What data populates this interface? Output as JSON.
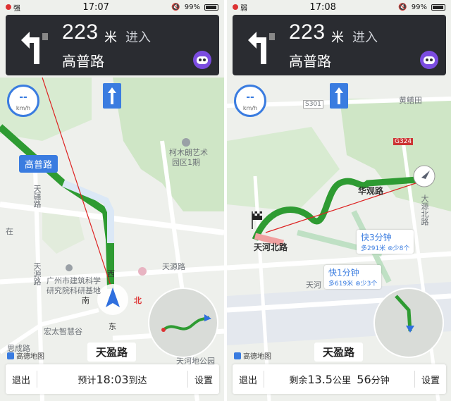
{
  "screens": [
    {
      "status": {
        "signal": "强",
        "time": "17:07",
        "battery": "99%"
      },
      "nav": {
        "distance": "223",
        "unit": "米",
        "action": "进入",
        "road": "高普路"
      },
      "speed": {
        "value": "--",
        "unit": "km/h"
      },
      "road_tag": "高普路",
      "labels": {
        "kemu": "柯木朗艺术",
        "kemu2": "园区1期",
        "tianzhen": "天疆路",
        "zai": "在",
        "tianyuan": "天源路",
        "institute1": "广州市建筑科学",
        "institute2": "研究院科研基地",
        "hongtai": "宏太智慧谷",
        "tianhe_park": "天河地公园",
        "tianyuan_lu": "天源路",
        "shi": "思成路"
      },
      "compass": {
        "west": "西",
        "south": "南",
        "east": "东",
        "north": "北"
      },
      "logo": "高德地图",
      "current_road": "天盈路",
      "bottom": {
        "exit": "退出",
        "middle_prefix": "预计",
        "middle_value": "18:03",
        "middle_suffix": "到达",
        "settings": "设置"
      }
    },
    {
      "status": {
        "signal": "弱",
        "time": "17:08",
        "battery": "99%"
      },
      "nav": {
        "distance": "223",
        "unit": "米",
        "action": "进入",
        "road": "高普路"
      },
      "speed": {
        "value": "--",
        "unit": "km/h"
      },
      "labels": {
        "huangjintian": "黄鳝田",
        "s301": "S301",
        "g324": "G324",
        "huaguan": "华观路",
        "tianhe_bei": "天河北路",
        "dayuan": "大源北路",
        "tianhe": "天河"
      },
      "routes": [
        {
          "label": "快3分钟",
          "dist": "多291米",
          "lights": "少8个"
        },
        {
          "label": "快1分钟",
          "dist": "多619米",
          "lights": "少3个"
        }
      ],
      "logo": "高德地图",
      "current_road": "天盈路",
      "bottom": {
        "exit": "退出",
        "middle_prefix": "剩余",
        "middle_value": "13.5",
        "middle_unit": "公里",
        "middle_time": "56",
        "middle_time_unit": "分钟",
        "settings": "设置"
      }
    }
  ],
  "colors": {
    "nav_bg": "#2a2c31",
    "accent": "#3a7ce0",
    "route_green": "#2e9b32",
    "alt_route": "#bfe0c4",
    "map_bg": "#eef0ec",
    "green_area": "#cfe6c6"
  }
}
